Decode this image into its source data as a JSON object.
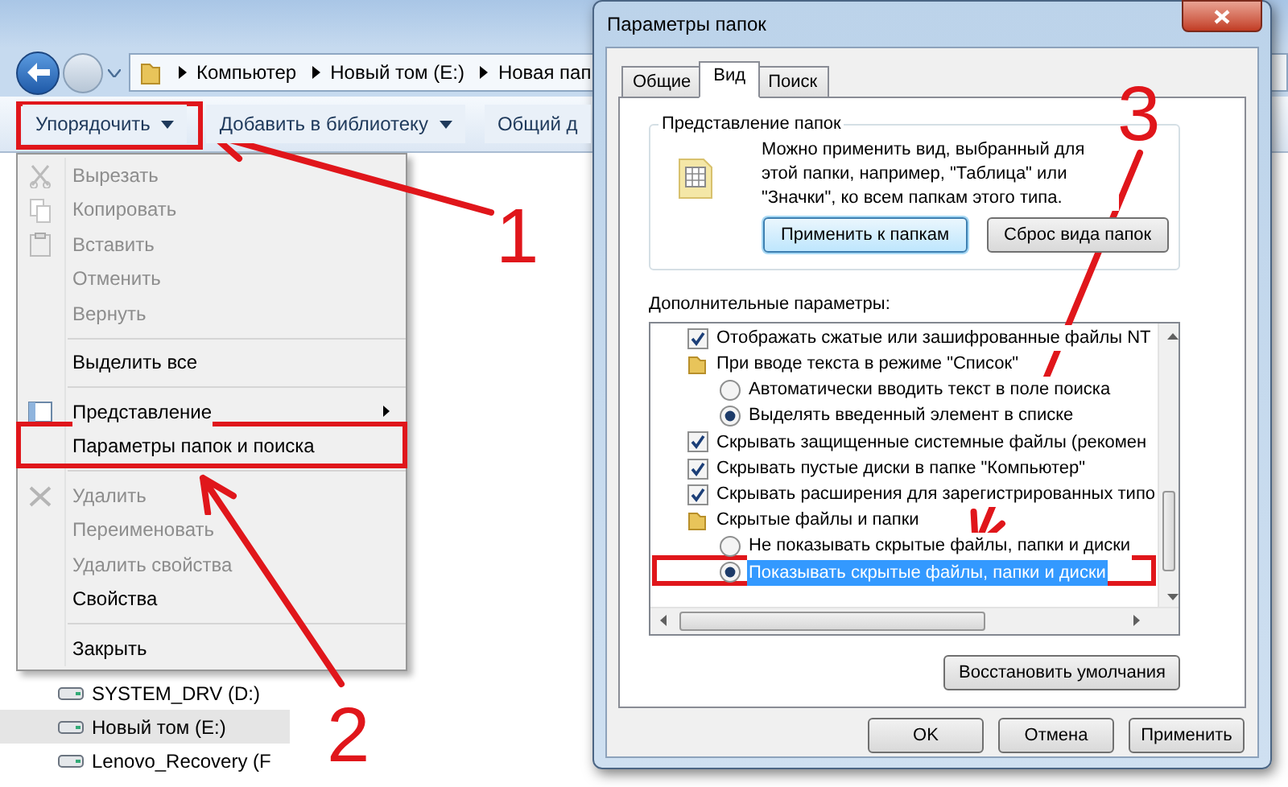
{
  "explorer": {
    "breadcrumb": [
      "Компьютер",
      "Новый том (E:)",
      "Новая пап"
    ],
    "toolbar": [
      {
        "label": "Упорядочить",
        "dropdown": true
      },
      {
        "label": "Добавить в библиотеку",
        "dropdown": true
      },
      {
        "label": "Общий д",
        "dropdown": false
      }
    ],
    "menu": [
      {
        "label": "Вырезать",
        "disabled": true
      },
      {
        "label": "Копировать",
        "disabled": true
      },
      {
        "label": "Вставить",
        "disabled": true
      },
      {
        "label": "Отменить",
        "disabled": true
      },
      {
        "label": "Вернуть",
        "disabled": true,
        "separator_after": true
      },
      {
        "label": "Выделить все",
        "disabled": false,
        "separator_after": true
      },
      {
        "label": "Представление",
        "disabled": false,
        "submenu": true
      },
      {
        "label": "Параметры папок и поиска",
        "disabled": false,
        "separator_after": true
      },
      {
        "label": "Удалить",
        "disabled": true
      },
      {
        "label": "Переименовать",
        "disabled": true
      },
      {
        "label": "Удалить свойства",
        "disabled": true
      },
      {
        "label": "Свойства",
        "disabled": false,
        "separator_after": true
      },
      {
        "label": "Закрыть",
        "disabled": false
      }
    ],
    "nav_items": [
      {
        "label": "SYSTEM_DRV (D:)",
        "selected": false
      },
      {
        "label": "Новый том (E:)",
        "selected": true
      },
      {
        "label": "Lenovo_Recovery (F",
        "selected": false
      }
    ]
  },
  "dialog": {
    "title": "Параметры папок",
    "tabs": [
      {
        "label": "Общие",
        "selected": false
      },
      {
        "label": "Вид",
        "selected": true
      },
      {
        "label": "Поиск",
        "selected": false
      }
    ],
    "group": {
      "legend": "Представление папок",
      "text": "Можно применить вид, выбранный для этой папки, например, \"Таблица\" или \"Значки\", ко всем папкам этого типа.",
      "buttons": [
        {
          "label": "Применить к папкам",
          "default": true
        },
        {
          "label": "Сброс вида папок",
          "default": false
        }
      ]
    },
    "advanced_label": "Дополнительные параметры:",
    "advanced": [
      {
        "kind": "checkbox",
        "label": "Отображать сжатые или зашифрованные файлы NT",
        "checked": true
      },
      {
        "kind": "folder",
        "label": "При вводе текста в режиме \"Список\"",
        "children": [
          {
            "kind": "radio",
            "label": "Автоматически вводить текст в поле поиска",
            "selected": false,
            "focused": false
          },
          {
            "kind": "radio",
            "label": "Выделять введенный элемент в списке",
            "selected": true,
            "focused": false
          }
        ]
      },
      {
        "kind": "checkbox",
        "label": "Скрывать защищенные системные файлы (рекомен",
        "checked": true
      },
      {
        "kind": "checkbox",
        "label": "Скрывать пустые диски в папке \"Компьютер\"",
        "checked": true
      },
      {
        "kind": "checkbox",
        "label": "Скрывать расширения для зарегистрированных типо",
        "checked": true
      },
      {
        "kind": "folder",
        "label": "Скрытые файлы и папки",
        "children": [
          {
            "kind": "radio",
            "label": "Не показывать скрытые файлы, папки и диски",
            "selected": false,
            "focused": false
          },
          {
            "kind": "radio",
            "label": "Показывать скрытые файлы, папки и диски",
            "selected": true,
            "focused": true
          }
        ]
      }
    ],
    "restore_button": "Восстановить умолчания",
    "buttons": [
      "OK",
      "Отмена",
      "Применить"
    ]
  },
  "annotations": [
    {
      "label": "1"
    },
    {
      "label": "2"
    },
    {
      "label": "3"
    }
  ]
}
